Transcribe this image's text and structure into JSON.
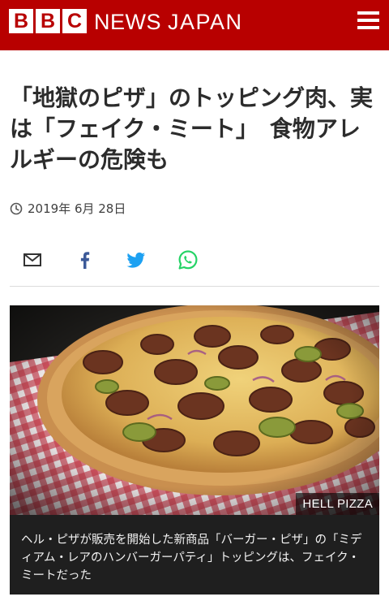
{
  "header": {
    "logo_letters": [
      "B",
      "B",
      "C"
    ],
    "brand_news": "NEWS",
    "brand_region": "JAPAN",
    "menu_icon": "hamburger-menu-icon",
    "bar_color": "#b80000"
  },
  "article": {
    "headline": "「地獄のピザ」のトッピング肉、実は「フェイク・ミート」　食物アレルギーの危険も",
    "date": "2019年 6月 28日",
    "share_icons": [
      "email-icon",
      "facebook-icon",
      "twitter-icon",
      "whatsapp-icon"
    ],
    "image": {
      "alt_subject": "pizza",
      "credit": "HELL PIZZA"
    },
    "caption": "ヘル・ピザが販売を開始した新商品「バーガー・ピザ」の「ミディアム・レアのハンバーガーパティ」トッピングは、フェイク・ミートだった"
  },
  "colors": {
    "twitter": "#1da1f2",
    "facebook": "#3b5998",
    "whatsapp": "#25d366"
  }
}
